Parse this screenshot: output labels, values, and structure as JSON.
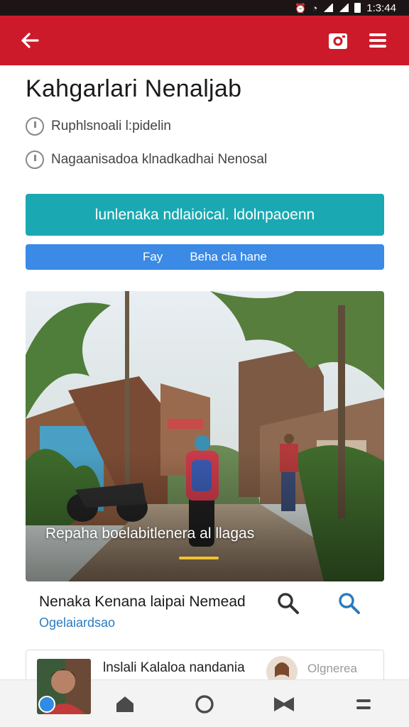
{
  "status_bar": {
    "time": "1:3:44"
  },
  "app_bar": {
    "back_icon": "arrow-left-icon",
    "camera_icon": "camera-icon",
    "menu_icon": "hamburger-menu-icon",
    "color": "#cc1a2a"
  },
  "page": {
    "title": "Kahgarlari Nenaljab",
    "meta": [
      {
        "icon": "clock-icon",
        "text": "Ruphlsnoali l:pidelin"
      },
      {
        "icon": "clock-icon",
        "text": "Nagaanisadoa klnadkadhai Nenosal"
      }
    ],
    "primary_button": "lunlenaka ndlaioical. ldolnpaoenn",
    "secondary_button": {
      "left": "Fay",
      "right": "Beha cla hane"
    },
    "accent_teal": "#1aa9b2",
    "accent_blue": "#3a8ae6"
  },
  "hero": {
    "caption": "Repaha boelabitlenera al llagas"
  },
  "article": {
    "title": "Nenaka Kenana laipai Nemead",
    "subtitle": "Ogelaiardsao",
    "search_icon": "search-icon"
  },
  "comment": {
    "text": "lnslali Kalaloa nandania",
    "action": "Olgnerea"
  },
  "bottom_nav": {
    "items": [
      {
        "icon": "home-icon"
      },
      {
        "icon": "circle-icon"
      },
      {
        "icon": "bowtie-icon"
      },
      {
        "icon": "menu-icon"
      }
    ]
  }
}
